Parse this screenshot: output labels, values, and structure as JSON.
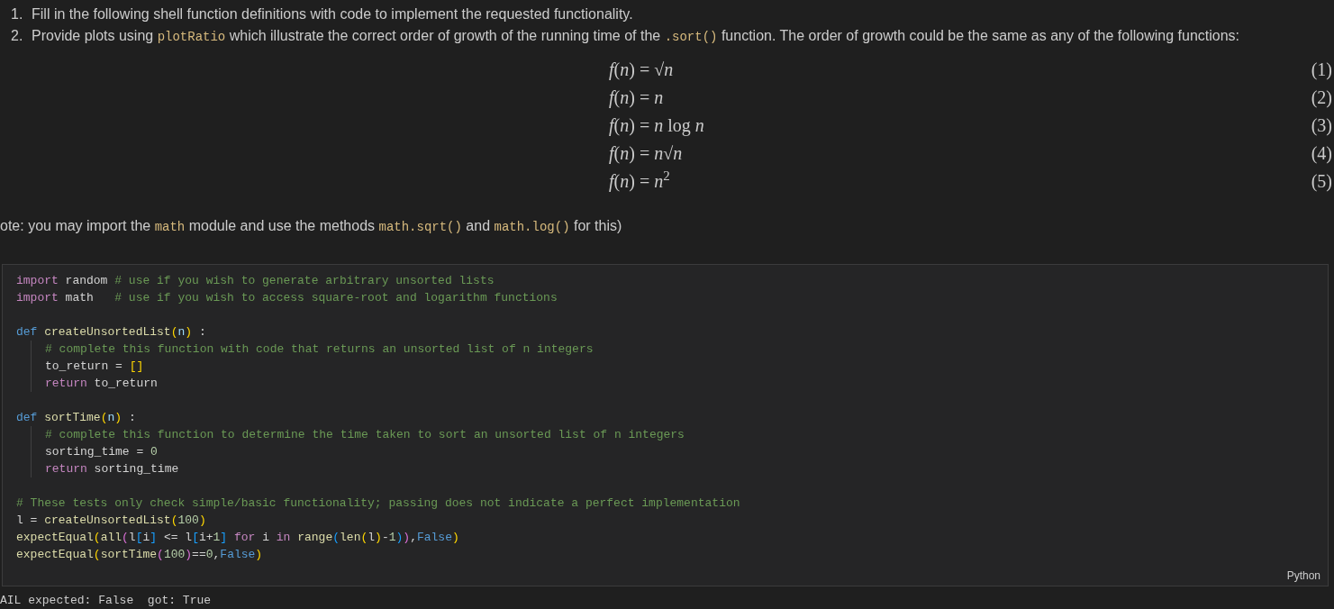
{
  "markdown": {
    "list_items": [
      [
        {
          "kind": "number",
          "text": "1."
        },
        {
          "kind": "text",
          "text": "Fill in the following shell function definitions with code to implement the requested functionality."
        }
      ],
      [
        {
          "kind": "number",
          "text": "2."
        },
        {
          "kind": "text",
          "text": "Provide plots using "
        },
        {
          "kind": "code",
          "text": "plotRatio"
        },
        {
          "kind": "text",
          "text": " which illustrate the correct order of growth of the running time of the "
        },
        {
          "kind": "code",
          "text": ".sort()"
        },
        {
          "kind": "text",
          "text": " function. The order of growth could be the same as any of the following functions:"
        }
      ]
    ],
    "equations": [
      {
        "formula": "*f*(*n*) = √*n*",
        "number": "(1)"
      },
      {
        "formula": "*f*(*n*) = *n*",
        "number": "(2)"
      },
      {
        "formula": "*f*(*n*) = *n* log *n*",
        "number": "(3)"
      },
      {
        "formula": "*f*(*n*) = *n*√*n*",
        "number": "(4)"
      },
      {
        "formula": "*f*(*n*) = *n*$^{2}$",
        "number": "(5)"
      }
    ],
    "note": [
      {
        "kind": "text",
        "text": "ote: you may import the "
      },
      {
        "kind": "code",
        "text": "math"
      },
      {
        "kind": "text",
        "text": " module and use the methods "
      },
      {
        "kind": "code",
        "text": "math.sqrt()"
      },
      {
        "kind": "text",
        "text": " and "
      },
      {
        "kind": "code",
        "text": "math.log()"
      },
      {
        "kind": "text",
        "text": " for this)"
      }
    ]
  },
  "code_cell": {
    "language": "Python",
    "lines": [
      {
        "tokens": [
          {
            "kind": "keyword",
            "text": "import"
          },
          {
            "kind": "plain",
            "text": " random "
          },
          {
            "kind": "comment",
            "text": "# use if you wish to generate arbitrary unsorted lists"
          }
        ]
      },
      {
        "tokens": [
          {
            "kind": "keyword",
            "text": "import"
          },
          {
            "kind": "plain",
            "text": " math   "
          },
          {
            "kind": "comment",
            "text": "# use if you wish to access square-root and logarithm functions"
          }
        ]
      },
      {
        "kind": "blank"
      },
      {
        "tokens": [
          {
            "kind": "storage",
            "text": "def "
          },
          {
            "kind": "function",
            "text": "createUnsortedList"
          },
          {
            "kind": "bracket1",
            "text": "("
          },
          {
            "kind": "param",
            "text": "n"
          },
          {
            "kind": "bracket1",
            "text": ")"
          },
          {
            "kind": "plain",
            "text": " :"
          }
        ],
        "children": [
          {
            "tokens": [
              {
                "kind": "comment",
                "text": "# complete this function with code that returns an unsorted list of n integers"
              }
            ]
          },
          {
            "tokens": [
              {
                "kind": "plain",
                "text": "to_return = "
              },
              {
                "kind": "bracket1",
                "text": "[]"
              }
            ]
          },
          {
            "tokens": [
              {
                "kind": "keyword",
                "text": "return"
              },
              {
                "kind": "plain",
                "text": " to_return"
              }
            ]
          }
        ]
      },
      {
        "kind": "blank"
      },
      {
        "tokens": [
          {
            "kind": "storage",
            "text": "def "
          },
          {
            "kind": "function",
            "text": "sortTime"
          },
          {
            "kind": "bracket1",
            "text": "("
          },
          {
            "kind": "param",
            "text": "n"
          },
          {
            "kind": "bracket1",
            "text": ")"
          },
          {
            "kind": "plain",
            "text": " :"
          }
        ],
        "children": [
          {
            "tokens": [
              {
                "kind": "comment",
                "text": "# complete this function to determine the time taken to sort an unsorted list of n integers"
              }
            ]
          },
          {
            "tokens": [
              {
                "kind": "plain",
                "text": "sorting_time = "
              },
              {
                "kind": "number",
                "text": "0"
              }
            ]
          },
          {
            "tokens": [
              {
                "kind": "keyword",
                "text": "return"
              },
              {
                "kind": "plain",
                "text": " sorting_time"
              }
            ]
          }
        ]
      },
      {
        "kind": "blank"
      },
      {
        "tokens": [
          {
            "kind": "comment",
            "text": "# These tests only check simple/basic functionality; passing does not indicate a perfect implementation"
          }
        ]
      },
      {
        "tokens": [
          {
            "kind": "plain",
            "text": "l = "
          },
          {
            "kind": "function",
            "text": "createUnsortedList"
          },
          {
            "kind": "bracket1",
            "text": "("
          },
          {
            "kind": "number",
            "text": "100"
          },
          {
            "kind": "bracket1",
            "text": ")"
          }
        ]
      },
      {
        "tokens": [
          {
            "kind": "function",
            "text": "expectEqual"
          },
          {
            "kind": "bracket1",
            "text": "("
          },
          {
            "kind": "function",
            "text": "all"
          },
          {
            "kind": "bracket2",
            "text": "("
          },
          {
            "kind": "plain",
            "text": "l"
          },
          {
            "kind": "bracket3",
            "text": "["
          },
          {
            "kind": "plain",
            "text": "i"
          },
          {
            "kind": "bracket3",
            "text": "]"
          },
          {
            "kind": "plain",
            "text": " <= l"
          },
          {
            "kind": "bracket3",
            "text": "["
          },
          {
            "kind": "plain",
            "text": "i+"
          },
          {
            "kind": "number",
            "text": "1"
          },
          {
            "kind": "bracket3",
            "text": "]"
          },
          {
            "kind": "keyword",
            "text": " for"
          },
          {
            "kind": "plain",
            "text": " i "
          },
          {
            "kind": "keyword",
            "text": "in "
          },
          {
            "kind": "function",
            "text": "range"
          },
          {
            "kind": "bracket3",
            "text": "("
          },
          {
            "kind": "function",
            "text": "len"
          },
          {
            "kind": "bracket1",
            "text": "("
          },
          {
            "kind": "plain",
            "text": "l"
          },
          {
            "kind": "bracket1",
            "text": ")"
          },
          {
            "kind": "plain",
            "text": "-"
          },
          {
            "kind": "number",
            "text": "1"
          },
          {
            "kind": "bracket3",
            "text": ")"
          },
          {
            "kind": "bracket2",
            "text": ")"
          },
          {
            "kind": "plain",
            "text": ","
          },
          {
            "kind": "storage",
            "text": "False"
          },
          {
            "kind": "bracket1",
            "text": ")"
          }
        ]
      },
      {
        "tokens": [
          {
            "kind": "function",
            "text": "expectEqual"
          },
          {
            "kind": "bracket1",
            "text": "("
          },
          {
            "kind": "function",
            "text": "sortTime"
          },
          {
            "kind": "bracket2",
            "text": "("
          },
          {
            "kind": "number",
            "text": "100"
          },
          {
            "kind": "bracket2",
            "text": ")"
          },
          {
            "kind": "plain",
            "text": "=="
          },
          {
            "kind": "number",
            "text": "0"
          },
          {
            "kind": "plain",
            "text": ","
          },
          {
            "kind": "storage",
            "text": "False"
          },
          {
            "kind": "bracket1",
            "text": ")"
          }
        ]
      }
    ]
  },
  "output": "AIL expected: False  got: True"
}
